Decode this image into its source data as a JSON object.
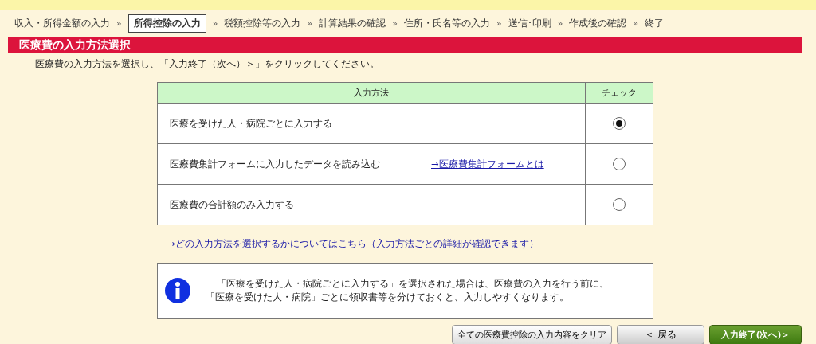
{
  "steps": [
    {
      "label": "収入・所得金額の入力",
      "selected": false
    },
    {
      "label": "所得控除の入力",
      "selected": true
    },
    {
      "label": "税額控除等の入力",
      "selected": false
    },
    {
      "label": "計算結果の確認",
      "selected": false
    },
    {
      "label": "住所・氏名等の入力",
      "selected": false
    },
    {
      "label": "送信･印刷",
      "selected": false
    },
    {
      "label": "作成後の確認",
      "selected": false
    },
    {
      "label": "終了",
      "selected": false
    }
  ],
  "step_separator": "»",
  "page_title": "医療費の入力方法選択",
  "instruction": "医療費の入力方法を選択し、「入力終了（次へ）＞」をクリックしてください。",
  "table": {
    "columns": [
      "入力方法",
      "チェック"
    ],
    "rows": [
      {
        "method": "医療を受けた人・病院ごとに入力する",
        "selected": true
      },
      {
        "method": "医療費集計フォームに入力したデータを読み込む",
        "link": "→医療費集計フォームとは",
        "selected": false
      },
      {
        "method": "医療費の合計額のみ入力する",
        "selected": false
      }
    ]
  },
  "help_link": "→どの入力方法を選択するかについてはこちら（入力方法ごとの詳細が確認できます）",
  "info": [
    "「医療を受けた人・病院ごとに入力する」を選択された場合は、医療費の入力を行う前に、",
    "「医療を受けた人・病院」ごとに領収書等を分けておくと、入力しやすくなります。"
  ],
  "buttons": [
    {
      "label": "全ての医療費控除の入力内容をクリア",
      "kind": "plain"
    },
    {
      "label": "＜ 戻る",
      "kind": "back"
    },
    {
      "label": "入力終了(次へ)＞",
      "kind": "next"
    }
  ]
}
